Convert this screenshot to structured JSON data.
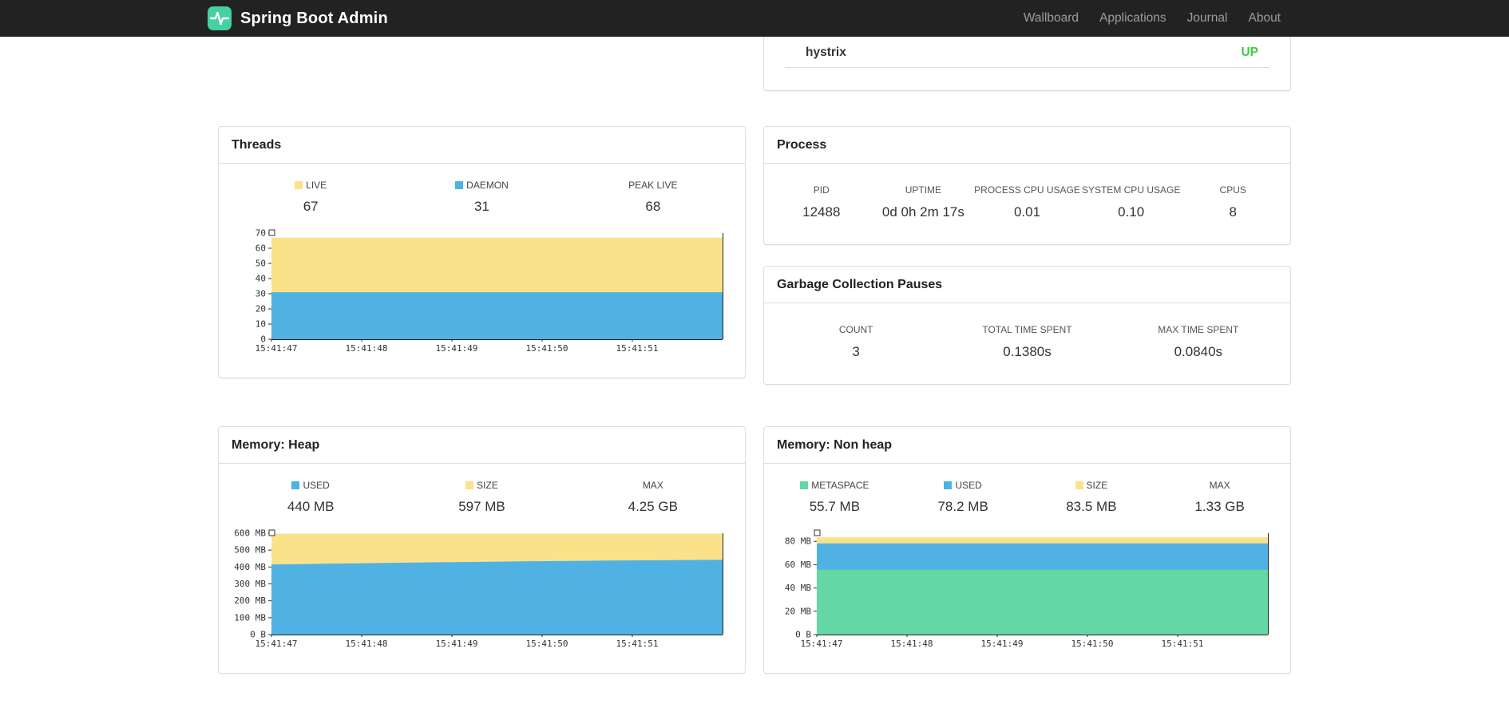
{
  "navbar": {
    "brand": "Spring Boot Admin",
    "links": [
      {
        "label": "Wallboard"
      },
      {
        "label": "Applications"
      },
      {
        "label": "Journal"
      },
      {
        "label": "About"
      }
    ]
  },
  "health": {
    "rows": [
      {
        "name": "hystrix",
        "status": "UP",
        "status_color": "#3fcc3f"
      }
    ]
  },
  "process": {
    "title": "Process",
    "metrics": [
      {
        "label": "PID",
        "value": "12488"
      },
      {
        "label": "UPTIME",
        "value": "0d 0h 2m 17s"
      },
      {
        "label": "PROCESS CPU USAGE",
        "value": "0.01"
      },
      {
        "label": "SYSTEM CPU USAGE",
        "value": "0.10"
      },
      {
        "label": "CPUS",
        "value": "8"
      }
    ]
  },
  "gc": {
    "title": "Garbage Collection Pauses",
    "metrics": [
      {
        "label": "COUNT",
        "value": "3"
      },
      {
        "label": "TOTAL TIME SPENT",
        "value": "0.1380s"
      },
      {
        "label": "MAX TIME SPENT",
        "value": "0.0840s"
      }
    ]
  },
  "threads": {
    "title": "Threads",
    "legend": [
      {
        "label": "LIVE",
        "value": "67",
        "color": "#fbe28a"
      },
      {
        "label": "DAEMON",
        "value": "31",
        "color": "#4fb2e3"
      },
      {
        "label": "PEAK LIVE",
        "value": "68"
      }
    ]
  },
  "heap": {
    "title": "Memory: Heap",
    "legend": [
      {
        "label": "USED",
        "value": "440 MB",
        "color": "#4fb2e3"
      },
      {
        "label": "SIZE",
        "value": "597 MB",
        "color": "#fbe28a"
      },
      {
        "label": "MAX",
        "value": "4.25 GB"
      }
    ]
  },
  "nonheap": {
    "title": "Memory: Non heap",
    "legend": [
      {
        "label": "METASPACE",
        "value": "55.7 MB",
        "color": "#63d8a5"
      },
      {
        "label": "USED",
        "value": "78.2 MB",
        "color": "#4fb2e3"
      },
      {
        "label": "SIZE",
        "value": "83.5 MB",
        "color": "#fbe28a"
      },
      {
        "label": "MAX",
        "value": "1.33 GB"
      }
    ]
  },
  "chart_data": [
    {
      "id": "threads",
      "type": "area",
      "title": "Threads",
      "height": 158,
      "x_labels": [
        "15:41:47",
        "15:41:48",
        "15:41:49",
        "15:41:50",
        "15:41:51"
      ],
      "x_label_step_fraction": 0.2,
      "y_max": 70,
      "y_ticks": [
        {
          "v": 0,
          "label": "0"
        },
        {
          "v": 10,
          "label": "10"
        },
        {
          "v": 20,
          "label": "20"
        },
        {
          "v": 30,
          "label": "30"
        },
        {
          "v": 40,
          "label": "40"
        },
        {
          "v": 50,
          "label": "50"
        },
        {
          "v": 60,
          "label": "60"
        },
        {
          "v": 70,
          "label": "70"
        }
      ],
      "series": [
        {
          "name": "DAEMON",
          "color": "#4fb2e3",
          "values": [
            31,
            31,
            31,
            31,
            31,
            31,
            31,
            31,
            31,
            31
          ]
        },
        {
          "name": "LIVE",
          "color": "#fbe28a",
          "values": [
            67,
            67,
            67,
            67,
            67,
            67,
            67,
            67,
            67,
            67
          ]
        }
      ]
    },
    {
      "id": "heap",
      "type": "area",
      "title": "Memory: Heap",
      "height": 152,
      "x_labels": [
        "15:41:47",
        "15:41:48",
        "15:41:49",
        "15:41:50",
        "15:41:51"
      ],
      "x_label_step_fraction": 0.2,
      "y_max": 600,
      "y_ticks": [
        {
          "v": 0,
          "label": "0 B"
        },
        {
          "v": 100,
          "label": "100 MB"
        },
        {
          "v": 200,
          "label": "200 MB"
        },
        {
          "v": 300,
          "label": "300 MB"
        },
        {
          "v": 400,
          "label": "400 MB"
        },
        {
          "v": 500,
          "label": "500 MB"
        },
        {
          "v": 600,
          "label": "600 MB"
        }
      ],
      "series": [
        {
          "name": "USED",
          "color": "#4fb2e3",
          "values": [
            415,
            419,
            423,
            427,
            430,
            433,
            436,
            439,
            441,
            443
          ]
        },
        {
          "name": "SIZE",
          "color": "#fbe28a",
          "values": [
            597,
            597,
            597,
            597,
            597,
            597,
            597,
            597,
            597,
            597
          ]
        }
      ]
    },
    {
      "id": "nonheap",
      "type": "area",
      "title": "Memory: Non heap",
      "height": 152,
      "x_labels": [
        "15:41:47",
        "15:41:48",
        "15:41:49",
        "15:41:50",
        "15:41:51"
      ],
      "x_label_step_fraction": 0.2,
      "y_max": 87,
      "y_ticks": [
        {
          "v": 0,
          "label": "0 B"
        },
        {
          "v": 20,
          "label": "20 MB"
        },
        {
          "v": 40,
          "label": "40 MB"
        },
        {
          "v": 60,
          "label": "60 MB"
        },
        {
          "v": 80,
          "label": "80 MB"
        }
      ],
      "series": [
        {
          "name": "METASPACE",
          "color": "#63d8a5",
          "values": [
            55.7,
            55.7,
            55.7,
            55.7,
            55.7,
            55.7,
            55.7,
            55.7,
            55.7,
            55.7
          ]
        },
        {
          "name": "USED",
          "color": "#4fb2e3",
          "values": [
            78.2,
            78.2,
            78.2,
            78.2,
            78.2,
            78.2,
            78.2,
            78.2,
            78.2,
            78.2
          ]
        },
        {
          "name": "SIZE",
          "color": "#fbe28a",
          "values": [
            83.5,
            83.5,
            83.5,
            83.5,
            83.5,
            83.5,
            83.5,
            83.5,
            83.5,
            83.5
          ]
        }
      ]
    }
  ]
}
